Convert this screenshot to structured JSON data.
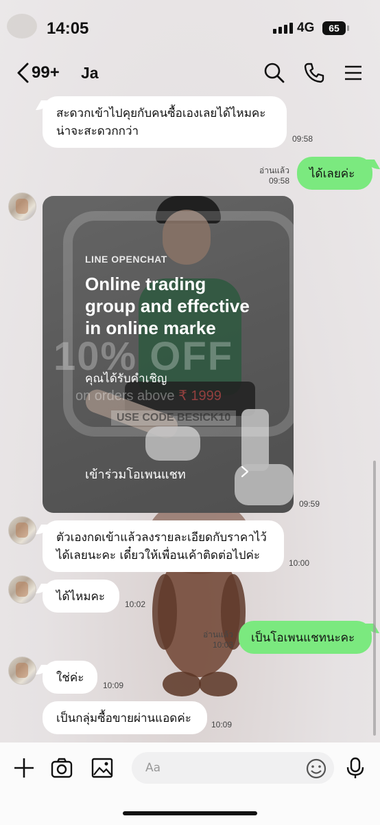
{
  "status_bar": {
    "time": "14:05",
    "network": "4G",
    "battery": "65"
  },
  "header": {
    "unread_count": "99+",
    "chat_name": "Ja",
    "icons": [
      "search-icon",
      "phone-icon",
      "menu-icon"
    ]
  },
  "messages": [
    {
      "side": "left",
      "lines": [
        "สะดวกเข้าไปคุยกับคนซื้อเองเลยได้ไหมคะ",
        "น่าจะสะดวกกว่า"
      ],
      "time": "09:58"
    },
    {
      "side": "right",
      "text": "ได้เลยค่ะ",
      "read": "อ่านแล้ว",
      "time": "09:58"
    },
    {
      "side": "left",
      "type": "invite",
      "time": "09:59"
    },
    {
      "side": "left",
      "lines": [
        "ตัวเองกดเข้าแล้วลงรายละเอียดกับราคาไว้",
        "ได้เลยนะคะ เดี๋ยวให้เพื่อนเค้าติดต่อไปค่ะ"
      ],
      "time": "10:00"
    },
    {
      "side": "left",
      "text": "ได้ไหมคะ",
      "time": "10:02"
    },
    {
      "side": "right",
      "text": "เป็นโอเพนแชทนะคะ",
      "read": "อ่านแล้ว",
      "time": "10:03"
    },
    {
      "side": "left",
      "text": "ใช่ค่ะ",
      "time": "10:09"
    },
    {
      "side": "left",
      "text": "เป็นกลุ่มซื้อขายผ่านแอดค่ะ",
      "time": "10:09"
    }
  ],
  "invite_card": {
    "brand": "LINE OPENCHAT",
    "title": "Online trading group and effective in online marke",
    "subtitle": "คุณได้รับคำเชิญ",
    "join_label": "เข้าร่วมโอเพนแชท",
    "image_text": {
      "offer": "10% OFF",
      "orders_prefix": "on orders above ",
      "orders_price": "₹ 1999",
      "code": "USE CODE BESICK10"
    }
  },
  "input_bar": {
    "placeholder": "Aa",
    "icons": [
      "plus-icon",
      "camera-icon",
      "image-icon",
      "emoji-icon",
      "microphone-icon"
    ]
  },
  "colors": {
    "sent_bubble": "#7be97f",
    "received_bubble": "#ffffff",
    "background": "#e8e4e5"
  }
}
